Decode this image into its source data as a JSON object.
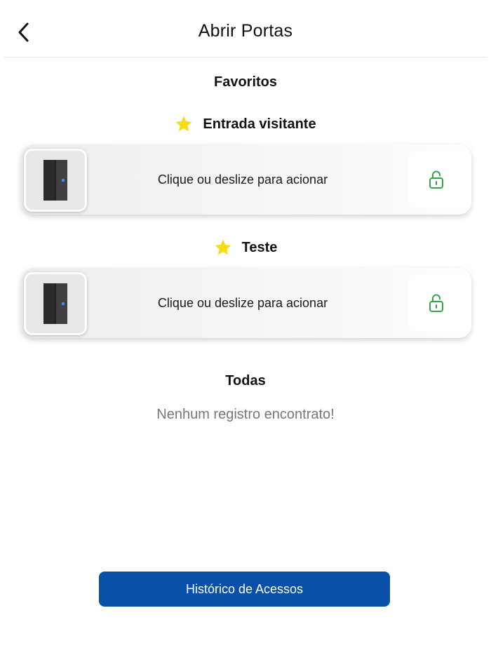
{
  "header": {
    "title": "Abrir Portas",
    "back_icon": "chevron-left-icon"
  },
  "favorites": {
    "title": "Favoritos",
    "doors": [
      {
        "name": "Entrada visitante",
        "star_icon": "star-icon",
        "action_text": "Clique ou deslize para acionar",
        "door_icon": "door-icon",
        "unlock_icon": "unlock-icon"
      },
      {
        "name": "Teste",
        "star_icon": "star-icon",
        "action_text": "Clique ou deslize para acionar",
        "door_icon": "door-icon",
        "unlock_icon": "unlock-icon"
      }
    ]
  },
  "all": {
    "title": "Todas",
    "empty_message": "Nenhum registro encontrato!"
  },
  "footer": {
    "history_button": "Histórico de Acessos"
  },
  "colors": {
    "primary": "#0a4fa8",
    "star": "#f5dc14",
    "unlock": "#3aa34a",
    "door_led": "#3b8ff5",
    "muted_text": "#777777"
  }
}
